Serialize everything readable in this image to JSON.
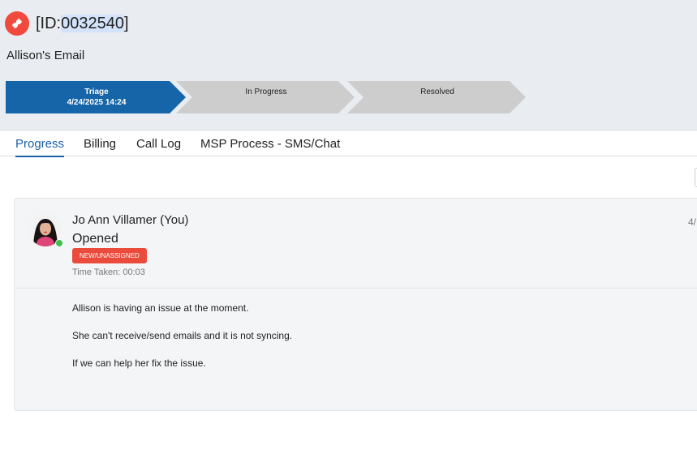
{
  "header": {
    "id_prefix": "[ID:",
    "id_number": "0032540",
    "id_suffix": "]",
    "subject": "Allison's Email",
    "icon": "ticket-icon"
  },
  "pipeline": {
    "stages": [
      {
        "name": "Triage",
        "date": "4/24/2025 14:24",
        "active": true
      },
      {
        "name": "In Progress",
        "date": "",
        "active": false
      },
      {
        "name": "Resolved",
        "date": "",
        "active": false
      }
    ],
    "colors": {
      "active": "#1565a8",
      "inactive": "#cdcdcd"
    }
  },
  "tabs": [
    {
      "label": "Progress",
      "active": true
    },
    {
      "label": "Billing",
      "active": false
    },
    {
      "label": "Call Log",
      "active": false
    },
    {
      "label": "MSP Process - SMS/Chat",
      "active": false
    }
  ],
  "activity": {
    "author": "Jo Ann Villamer (You)",
    "action": "Opened",
    "status_badge": "NEW/UNASSIGNED",
    "time_taken": "Time Taken: 00:03",
    "date_partial": "4/",
    "online": true,
    "lines": [
      "Allison is having an issue at the moment.",
      "She can't receive/send emails and it is not syncing.",
      "If we can help her fix the issue."
    ]
  }
}
